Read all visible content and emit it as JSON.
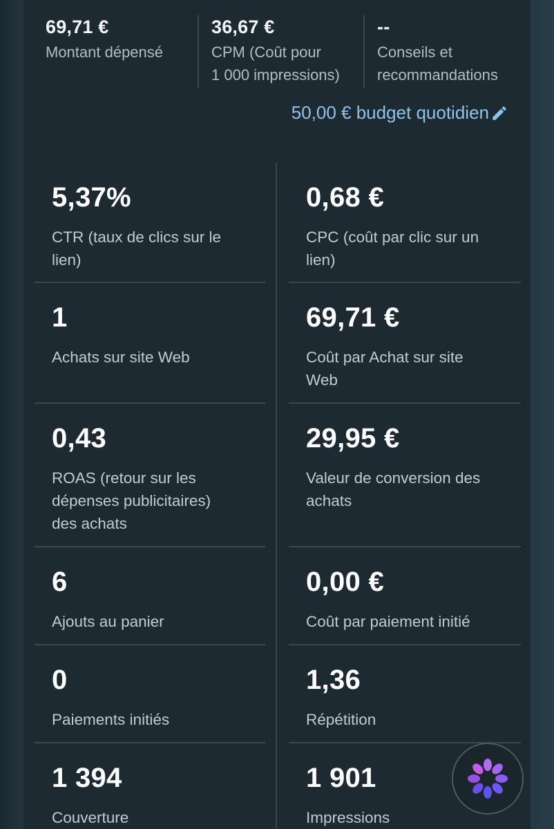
{
  "summary": [
    {
      "value": "69,71 €",
      "label_lines": [
        "Montant dépensé"
      ]
    },
    {
      "value": "36,67 €",
      "label_lines": [
        "CPM (Coût pour",
        "1 000 impressions)"
      ]
    },
    {
      "value": "--",
      "label_lines": [
        "Conseils et",
        "recommandations"
      ]
    }
  ],
  "budget": {
    "label": "50,00 € budget quotidien",
    "icon": "pencil-icon"
  },
  "metrics": [
    {
      "left": {
        "value": "5,37%",
        "label_lines": [
          "CTR (taux de clics sur le",
          "lien)"
        ]
      },
      "right": {
        "value": "0,68 €",
        "label_lines": [
          "CPC (coût par clic sur un",
          "lien)"
        ]
      }
    },
    {
      "left": {
        "value": "1",
        "label_lines": [
          "Achats sur site Web"
        ]
      },
      "right": {
        "value": "69,71 €",
        "label_lines": [
          "Coût par Achat sur site",
          "Web"
        ]
      }
    },
    {
      "left": {
        "value": "0,43",
        "label_lines": [
          "ROAS (retour sur les",
          "dépenses publicitaires)",
          "des achats"
        ]
      },
      "right": {
        "value": "29,95 €",
        "label_lines": [
          "Valeur de conversion des",
          "achats"
        ]
      }
    },
    {
      "left": {
        "value": "6",
        "label_lines": [
          "Ajouts au panier"
        ]
      },
      "right": {
        "value": "0,00 €",
        "label_lines": [
          "Coût par paiement initié"
        ]
      }
    },
    {
      "left": {
        "value": "0",
        "label_lines": [
          "Paiements initiés"
        ]
      },
      "right": {
        "value": "1,36",
        "label_lines": [
          "Répétition"
        ]
      }
    },
    {
      "left": {
        "value": "1 394",
        "label_lines": [
          "Couverture"
        ]
      },
      "right": {
        "value": "1 901",
        "label_lines": [
          "Impressions"
        ]
      }
    }
  ],
  "fab": {
    "icon": "meta-ai-icon"
  },
  "colors": {
    "panel_bg": "#1e2a32",
    "link": "#8ec3ec",
    "divider": "#3b4852"
  }
}
